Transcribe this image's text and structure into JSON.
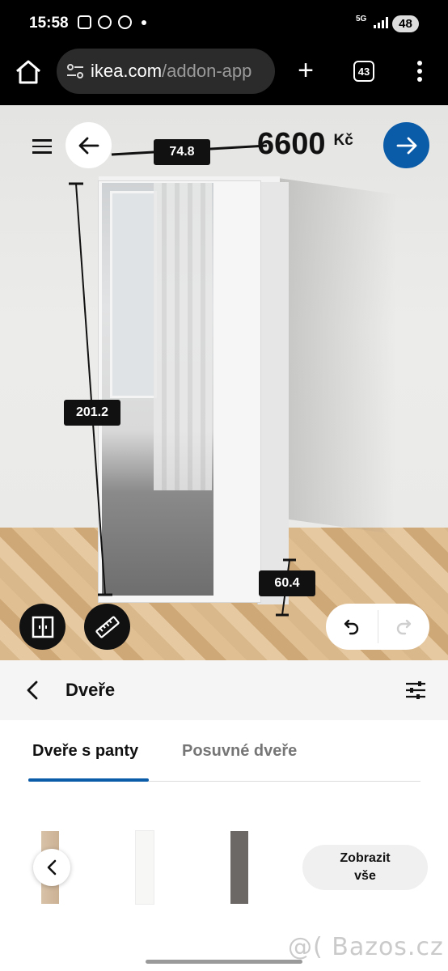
{
  "status_bar": {
    "time": "15:58",
    "network": "5G",
    "battery": "48"
  },
  "browser": {
    "url_domain": "ikea.com",
    "url_path": "/addon-app",
    "tab_count": "43"
  },
  "configurator": {
    "price": "6600",
    "currency": "Kč",
    "dimensions": {
      "width": "74.8",
      "height": "201.2",
      "depth": "60.4"
    }
  },
  "panel": {
    "title": "Dveře",
    "tabs": [
      {
        "label": "Dveře s panty"
      },
      {
        "label": "Posuvné dveře"
      }
    ],
    "show_all_label": "Zobrazit vše",
    "options": [
      {
        "name": "oak-effect-door"
      },
      {
        "name": "white-door"
      },
      {
        "name": "dark-grey-door"
      }
    ]
  },
  "watermark": "@( Bazos.cz",
  "colors": {
    "accent": "#0a5ba8",
    "dark": "#111111",
    "panel_bg": "#f5f5f5"
  }
}
